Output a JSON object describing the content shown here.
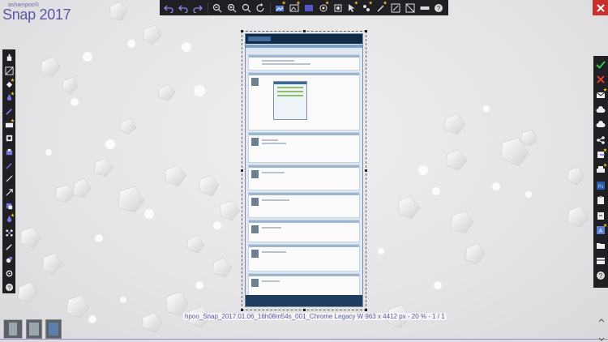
{
  "brand": {
    "small": "ashampoo®",
    "name": "Snap",
    "year": "2017"
  },
  "top_toolbar": {
    "buttons": [
      "undo-icon",
      "undo-all-icon",
      "redo-icon",
      "zoom-out-icon",
      "zoom-in-icon",
      "zoom-fit-icon",
      "rotate-icon",
      "effects-icon",
      "image-icon",
      "rectangle-icon",
      "crop-icon",
      "wand-icon",
      "cursor-icon",
      "blur-icon",
      "pen-icon",
      "resize-icon",
      "split-icon",
      "ruler-icon",
      "help-icon"
    ]
  },
  "left_toolbar": {
    "buttons": [
      "hand-icon",
      "selection-icon",
      "fill-icon",
      "drop-icon",
      "marker-icon",
      "text-icon",
      "stamp-icon",
      "counter-icon",
      "brush-icon",
      "line-icon",
      "arrow-icon",
      "eraser-icon",
      "paint-icon",
      "pixelate-icon",
      "pencil-icon",
      "shapes-icon",
      "settings-icon",
      "help-icon"
    ]
  },
  "right_toolbar": {
    "buttons": [
      "accept-icon",
      "discard-icon",
      "mail-icon",
      "cloud-icon",
      "cloud-upload-icon",
      "share-icon",
      "export-icon",
      "print-icon",
      "photoshop-icon",
      "clipboard-icon",
      "open-icon",
      "save-icon",
      "folder-icon",
      "more-icon",
      "help-icon"
    ]
  },
  "status": {
    "text": "hpoo_Snap_2017.01.06_16h08m54s_001_Chrome Legacy W 963 x 4412 px - 20 % - 1 / 1"
  },
  "thumbnails": [
    "thumb-1",
    "thumb-2",
    "thumb-3"
  ],
  "colors": {
    "accent": "#5a57a6",
    "close": "#c9302c",
    "toolbar": "#1f1f24"
  }
}
